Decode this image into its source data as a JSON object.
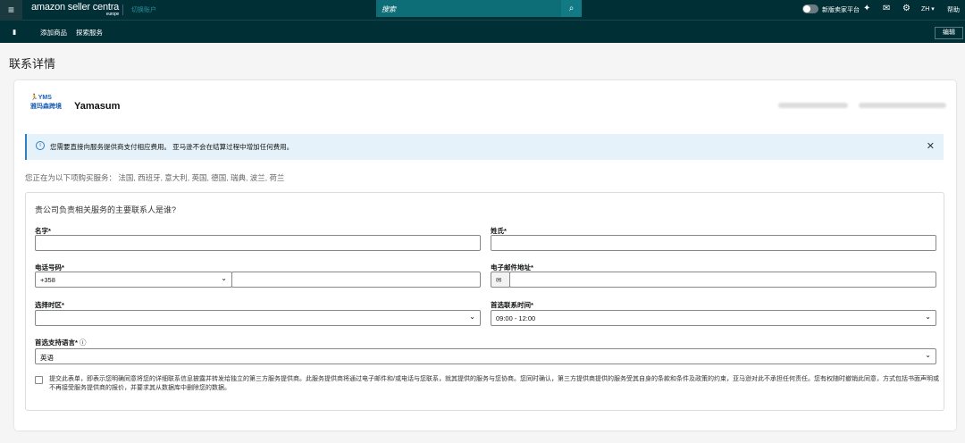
{
  "header": {
    "logo": "amazon seller centra",
    "region": "europe",
    "switch_account": "切换账户",
    "search_placeholder": "搜索",
    "new_platform": "新版卖家平台",
    "lang": "ZH",
    "help": "帮助"
  },
  "subnav": {
    "items": [
      "添加商品",
      "探索服务"
    ],
    "edit": "编辑"
  },
  "page_title": "联系详情",
  "provider": {
    "logo_text": "YMS 雅玛森跨境",
    "name": "Yamasum"
  },
  "alert": "您需要直接向服务提供商支付相应费用。 亚马逊不会在结算过程中增加任何费用。",
  "services_text": "您正在为以下项购买服务： 法国, 西班牙, 意大利, 英国, 德国, 瑞典, 波兰, 荷兰",
  "form": {
    "question": "贵公司负责相关服务的主要联系人是谁?",
    "first_name": "名字*",
    "last_name": "姓氏*",
    "phone": "电话号码*",
    "phone_code": "+358",
    "email": "电子邮件地址*",
    "timezone": "选择时区*",
    "contact_time": "首选联系时间*",
    "contact_time_value": "09:00 - 12:00",
    "language": "首选支持语言*",
    "language_value": "英语",
    "consent": "提交此表单，即表示您明确同意将您的详细联系信息披露并转发给独立的第三方服务提供商。此服务提供商将通过电子邮件和/或电话与您联系，就其提供的服务与您协商。您同时确认，第三方提供商提供的服务受其自身的条款和条件及政策的约束，亚马逊对此不承担任何责任。您有权随时撤销此同意，方式包括书面声明或不再接受服务提供商的报价，并要求其从数据库中删除您的数据。"
  }
}
